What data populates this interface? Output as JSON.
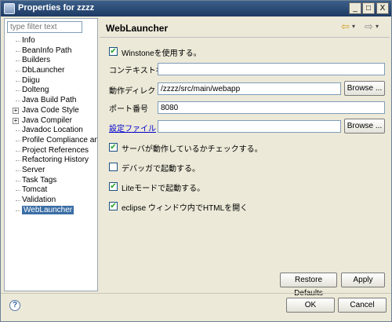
{
  "window": {
    "title": "Properties for zzzz",
    "min_glyph": "_",
    "max_glyph": "□",
    "close_glyph": "X"
  },
  "sidebar": {
    "filter_placeholder": "type filter text",
    "items": [
      {
        "label": "Info",
        "expandable": false
      },
      {
        "label": "BeanInfo Path",
        "expandable": false
      },
      {
        "label": "Builders",
        "expandable": false
      },
      {
        "label": "DbLauncher",
        "expandable": false
      },
      {
        "label": "Diigu",
        "expandable": false
      },
      {
        "label": "Dolteng",
        "expandable": false
      },
      {
        "label": "Java Build Path",
        "expandable": false
      },
      {
        "label": "Java Code Style",
        "expandable": true
      },
      {
        "label": "Java Compiler",
        "expandable": true
      },
      {
        "label": "Javadoc Location",
        "expandable": false
      },
      {
        "label": "Profile Compliance and Va",
        "expandable": false
      },
      {
        "label": "Project References",
        "expandable": false
      },
      {
        "label": "Refactoring History",
        "expandable": false
      },
      {
        "label": "Server",
        "expandable": false
      },
      {
        "label": "Task Tags",
        "expandable": false
      },
      {
        "label": "Tomcat",
        "expandable": false
      },
      {
        "label": "Validation",
        "expandable": false
      },
      {
        "label": "WebLauncher",
        "expandable": false,
        "selected": true
      }
    ]
  },
  "page": {
    "title": "WebLauncher",
    "nav_back_glyph": "⇦",
    "nav_forward_glyph": "⇨",
    "nav_menu_glyph": "▾",
    "use_winstone": {
      "label": "Winstoneを使用する。",
      "checked": true
    },
    "context_name": {
      "label": "コンテキスト名",
      "value": ""
    },
    "working_dir": {
      "label": "動作ディレクトリ",
      "value": "/zzzz/src/main/webapp",
      "browse_label": "Browse ..."
    },
    "port": {
      "label": "ポート番号",
      "value": "8080"
    },
    "config_file": {
      "label": "設定ファイル",
      "value": "",
      "browse_label": "Browse ..."
    },
    "check_server": {
      "label": "サーバが動作しているかチェックする。",
      "checked": true
    },
    "debug_mode": {
      "label": "デバッガで起動する。",
      "checked": false
    },
    "lite_mode": {
      "label": "Liteモードで起動する。",
      "checked": true
    },
    "open_html": {
      "label": "eclipse ウィンドウ内でHTMLを開く",
      "checked": true
    },
    "restore_defaults_label": "Restore Defaults",
    "apply_label": "Apply"
  },
  "footer": {
    "help_glyph": "?",
    "ok_label": "OK",
    "cancel_label": "Cancel"
  },
  "check_glyph": "✔"
}
